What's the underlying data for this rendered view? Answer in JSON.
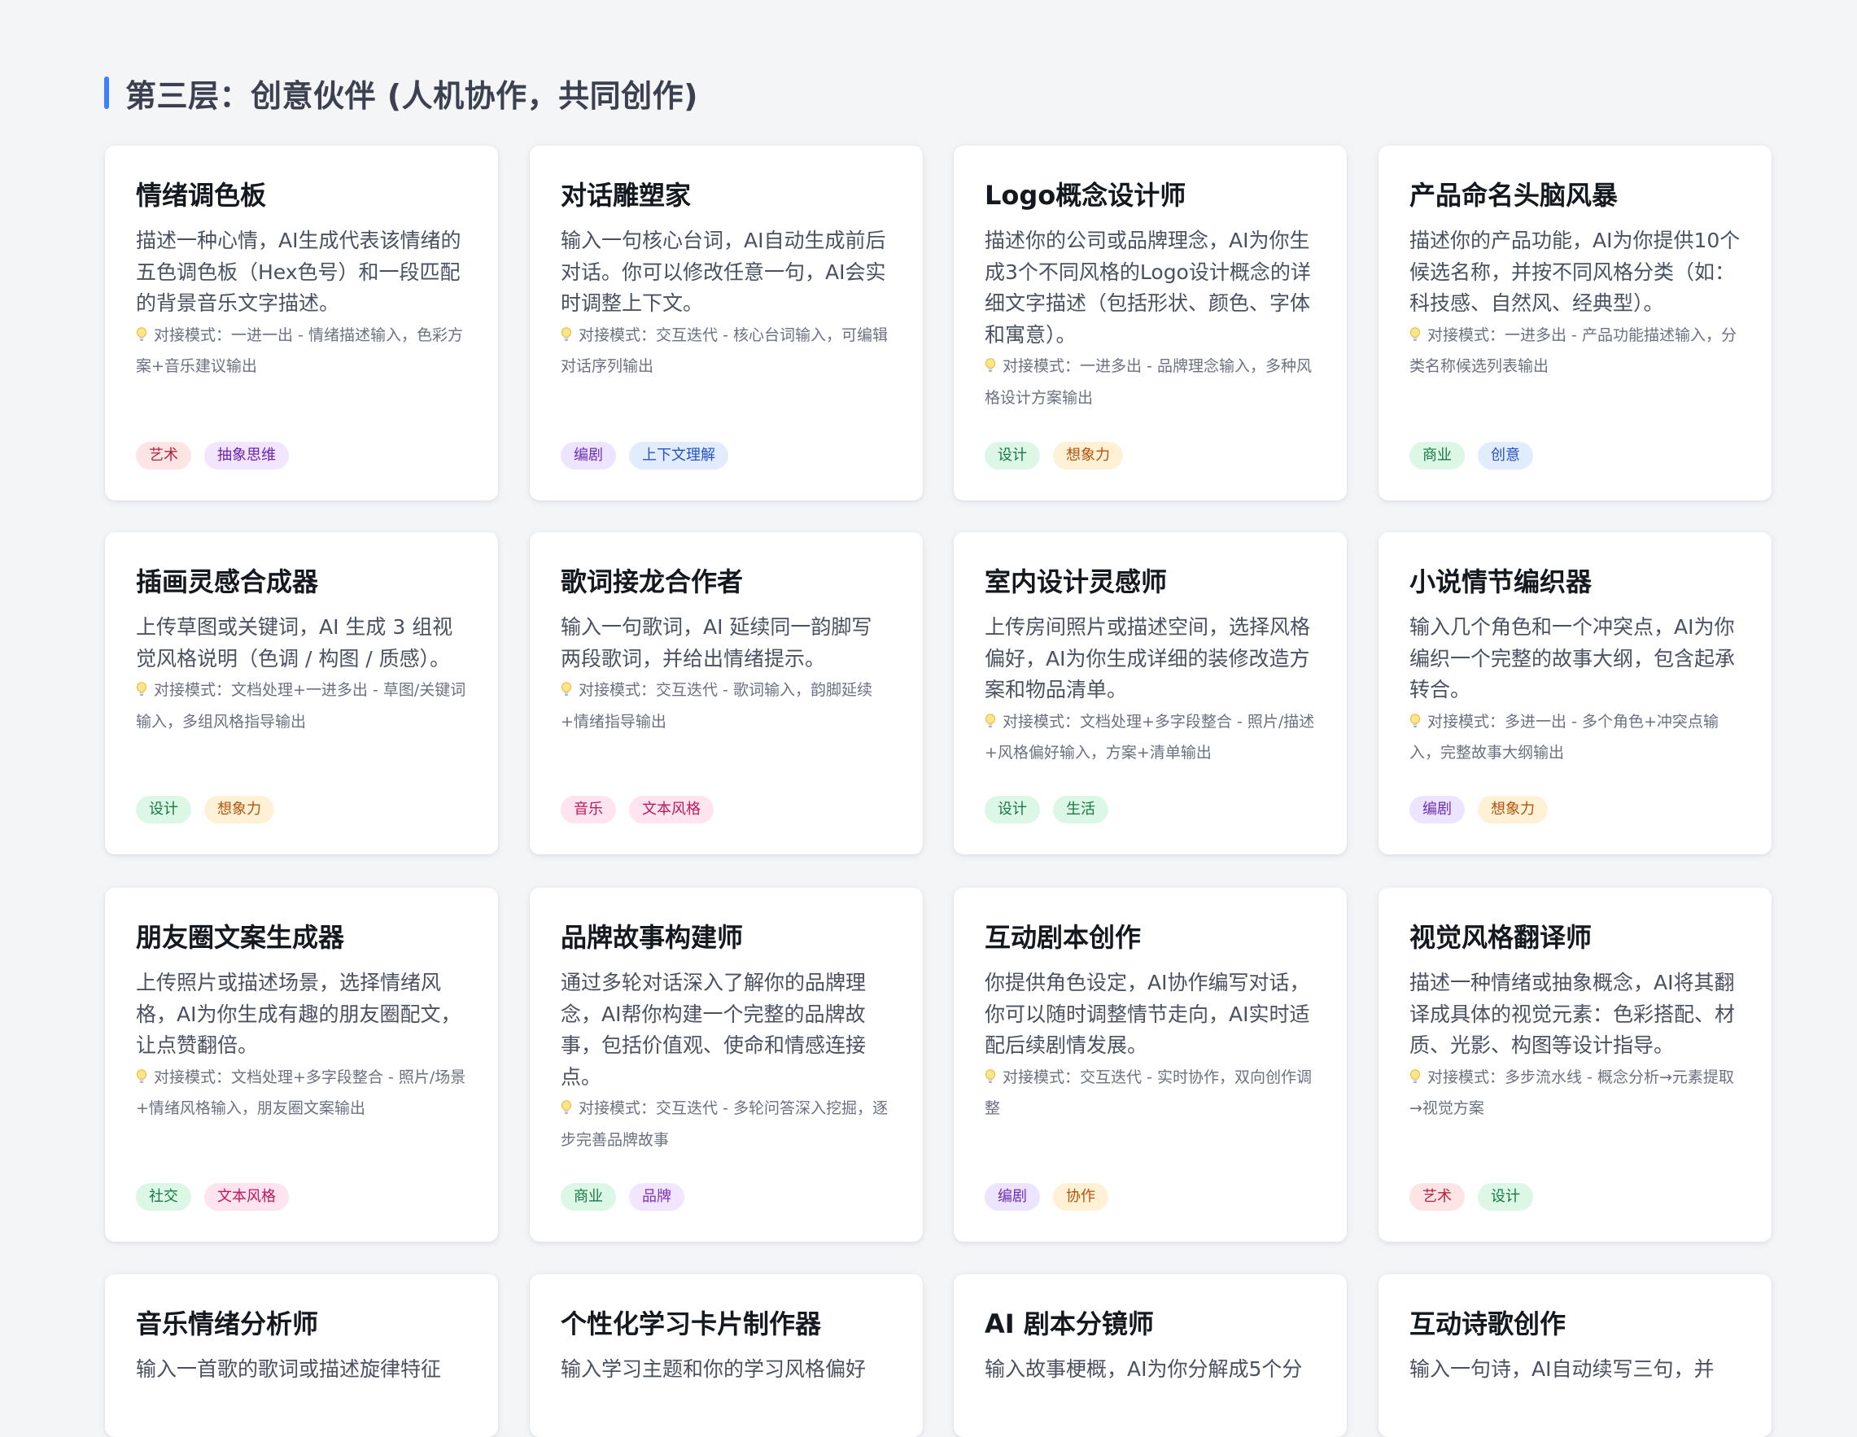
{
  "section": {
    "title": "第三层：创意伙伴 (人机协作，共同创作)"
  },
  "mode_prefix": "对接模式：",
  "cards": [
    {
      "title": "情绪调色板",
      "desc": "描述一种心情，AI生成代表该情绪的五色调色板（Hex色号）和一段匹配的背景音乐文字描述。",
      "mode": "一进一出 - 情绪描述输入，色彩方案+音乐建议输出",
      "tags": [
        {
          "label": "艺术",
          "type": "art"
        },
        {
          "label": "抽象思维",
          "type": "abstract"
        }
      ]
    },
    {
      "title": "对话雕塑家",
      "desc": "输入一句核心台词，AI自动生成前后对话。你可以修改任意一句，AI会实时调整上下文。",
      "mode": "交互迭代 - 核心台词输入，可编辑对话序列输出",
      "tags": [
        {
          "label": "编剧",
          "type": "script"
        },
        {
          "label": "上下文理解",
          "type": "context"
        }
      ]
    },
    {
      "title": "Logo概念设计师",
      "desc": "描述你的公司或品牌理念，AI为你生成3个不同风格的Logo设计概念的详细文字描述（包括形状、颜色、字体和寓意）。",
      "mode": "一进多出 - 品牌理念输入，多种风格设计方案输出",
      "tags": [
        {
          "label": "设计",
          "type": "design"
        },
        {
          "label": "想象力",
          "type": "imagination"
        }
      ]
    },
    {
      "title": "产品命名头脑风暴",
      "desc": "描述你的产品功能，AI为你提供10个候选名称，并按不同风格分类（如：科技感、自然风、经典型）。",
      "mode": "一进多出 - 产品功能描述输入，分类名称候选列表输出",
      "tags": [
        {
          "label": "商业",
          "type": "business"
        },
        {
          "label": "创意",
          "type": "creative"
        }
      ]
    },
    {
      "title": "插画灵感合成器",
      "desc": "上传草图或关键词，AI 生成 3 组视觉风格说明（色调 / 构图 / 质感）。",
      "mode": "文档处理+一进多出 - 草图/关键词输入，多组风格指导输出",
      "tags": [
        {
          "label": "设计",
          "type": "design"
        },
        {
          "label": "想象力",
          "type": "imagination"
        }
      ]
    },
    {
      "title": "歌词接龙合作者",
      "desc": "输入一句歌词，AI 延续同一韵脚写两段歌词，并给出情绪提示。",
      "mode": "交互迭代 - 歌词输入，韵脚延续+情绪指导输出",
      "tags": [
        {
          "label": "音乐",
          "type": "music"
        },
        {
          "label": "文本风格",
          "type": "style"
        }
      ]
    },
    {
      "title": "室内设计灵感师",
      "desc": "上传房间照片或描述空间，选择风格偏好，AI为你生成详细的装修改造方案和物品清单。",
      "mode": "文档处理+多字段整合 - 照片/描述+风格偏好输入，方案+清单输出",
      "tags": [
        {
          "label": "设计",
          "type": "design"
        },
        {
          "label": "生活",
          "type": "life"
        }
      ]
    },
    {
      "title": "小说情节编织器",
      "desc": "输入几个角色和一个冲突点，AI为你编织一个完整的故事大纲，包含起承转合。",
      "mode": "多进一出 - 多个角色+冲突点输入，完整故事大纲输出",
      "tags": [
        {
          "label": "编剧",
          "type": "script"
        },
        {
          "label": "想象力",
          "type": "imagination"
        }
      ]
    },
    {
      "title": "朋友圈文案生成器",
      "desc": "上传照片或描述场景，选择情绪风格，AI为你生成有趣的朋友圈配文，让点赞翻倍。",
      "mode": "文档处理+多字段整合 - 照片/场景+情绪风格输入，朋友圈文案输出",
      "tags": [
        {
          "label": "社交",
          "type": "social"
        },
        {
          "label": "文本风格",
          "type": "style"
        }
      ]
    },
    {
      "title": "品牌故事构建师",
      "desc": "通过多轮对话深入了解你的品牌理念，AI帮你构建一个完整的品牌故事，包括价值观、使命和情感连接点。",
      "mode": "交互迭代 - 多轮问答深入挖掘，逐步完善品牌故事",
      "tags": [
        {
          "label": "商业",
          "type": "business"
        },
        {
          "label": "品牌",
          "type": "brand"
        }
      ]
    },
    {
      "title": "互动剧本创作",
      "desc": "你提供角色设定，AI协作编写对话，你可以随时调整情节走向，AI实时适配后续剧情发展。",
      "mode": "交互迭代 - 实时协作，双向创作调整",
      "tags": [
        {
          "label": "编剧",
          "type": "script"
        },
        {
          "label": "协作",
          "type": "collab"
        }
      ]
    },
    {
      "title": "视觉风格翻译师",
      "desc": "描述一种情绪或抽象概念，AI将其翻译成具体的视觉元素：色彩搭配、材质、光影、构图等设计指导。",
      "mode": "多步流水线 - 概念分析→元素提取→视觉方案",
      "tags": [
        {
          "label": "艺术",
          "type": "art"
        },
        {
          "label": "设计",
          "type": "design"
        }
      ]
    },
    {
      "title": "音乐情绪分析师",
      "desc": "输入一首歌的歌词或描述旋律特征",
      "mode": "",
      "tags": []
    },
    {
      "title": "个性化学习卡片制作器",
      "desc": "输入学习主题和你的学习风格偏好",
      "mode": "",
      "tags": []
    },
    {
      "title": "AI 剧本分镜师",
      "desc": "输入故事梗概，AI为你分解成5个分",
      "mode": "",
      "tags": []
    },
    {
      "title": "互动诗歌创作",
      "desc": "输入一句诗，AI自动续写三句，并",
      "mode": "",
      "tags": []
    }
  ]
}
